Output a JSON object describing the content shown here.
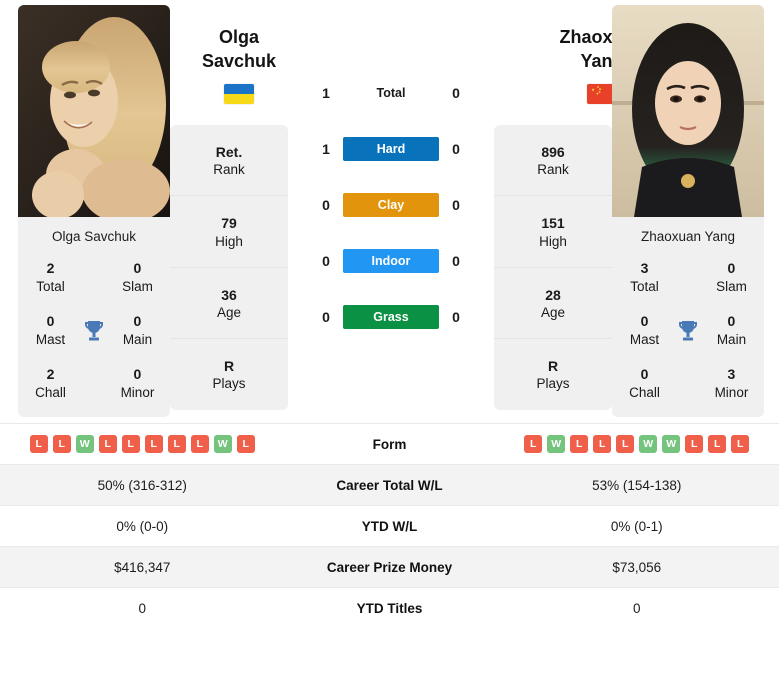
{
  "players": {
    "left": {
      "first_name": "Olga",
      "last_name": "Savchuk",
      "full_name": "Olga Savchuk",
      "flag": "ukraine-flag",
      "titles": {
        "total": "2",
        "total_label": "Total",
        "slam": "0",
        "slam_label": "Slam",
        "mast": "0",
        "mast_label": "Mast",
        "main": "0",
        "main_label": "Main",
        "chall": "2",
        "chall_label": "Chall",
        "minor": "0",
        "minor_label": "Minor"
      },
      "stats": [
        {
          "value": "Ret.",
          "label": "Rank"
        },
        {
          "value": "79",
          "label": "High"
        },
        {
          "value": "36",
          "label": "Age"
        },
        {
          "value": "R",
          "label": "Plays"
        }
      ],
      "form": [
        "L",
        "L",
        "W",
        "L",
        "L",
        "L",
        "L",
        "L",
        "W",
        "L"
      ],
      "career_total_wl": "50% (316-312)",
      "ytd_wl": "0% (0-0)",
      "career_prize_money": "$416,347",
      "ytd_titles": "0"
    },
    "right": {
      "first_name": "Zhaoxuan",
      "last_name": "Yang",
      "full_name": "Zhaoxuan Yang",
      "flag": "china-flag",
      "titles": {
        "total": "3",
        "total_label": "Total",
        "slam": "0",
        "slam_label": "Slam",
        "mast": "0",
        "mast_label": "Mast",
        "main": "0",
        "main_label": "Main",
        "chall": "0",
        "chall_label": "Chall",
        "minor": "3",
        "minor_label": "Minor"
      },
      "stats": [
        {
          "value": "896",
          "label": "Rank"
        },
        {
          "value": "151",
          "label": "High"
        },
        {
          "value": "28",
          "label": "Age"
        },
        {
          "value": "R",
          "label": "Plays"
        }
      ],
      "form": [
        "L",
        "W",
        "L",
        "L",
        "L",
        "W",
        "W",
        "L",
        "L",
        "L"
      ],
      "career_total_wl": "53% (154-138)",
      "ytd_wl": "0% (0-1)",
      "career_prize_money": "$73,056",
      "ytd_titles": "0"
    }
  },
  "h2h": [
    {
      "label": "Total",
      "left": "1",
      "right": "0",
      "chip": false,
      "color": ""
    },
    {
      "label": "Hard",
      "left": "1",
      "right": "0",
      "chip": true,
      "color": "#0873bb"
    },
    {
      "label": "Clay",
      "left": "0",
      "right": "0",
      "chip": true,
      "color": "#e3940d"
    },
    {
      "label": "Indoor",
      "left": "0",
      "right": "0",
      "chip": true,
      "color": "#2196f3"
    },
    {
      "label": "Grass",
      "left": "0",
      "right": "0",
      "chip": true,
      "color": "#0a9144"
    }
  ],
  "table": {
    "rows": [
      {
        "label": "Form",
        "type": "form"
      },
      {
        "label": "Career Total W/L",
        "type": "text",
        "key": "career_total_wl"
      },
      {
        "label": "YTD W/L",
        "type": "text",
        "key": "ytd_wl"
      },
      {
        "label": "Career Prize Money",
        "type": "text",
        "key": "career_prize_money"
      },
      {
        "label": "YTD Titles",
        "type": "text",
        "key": "ytd_titles"
      }
    ]
  },
  "icons": {
    "trophy": "trophy-icon",
    "trophy_color": "#4a79b8"
  }
}
